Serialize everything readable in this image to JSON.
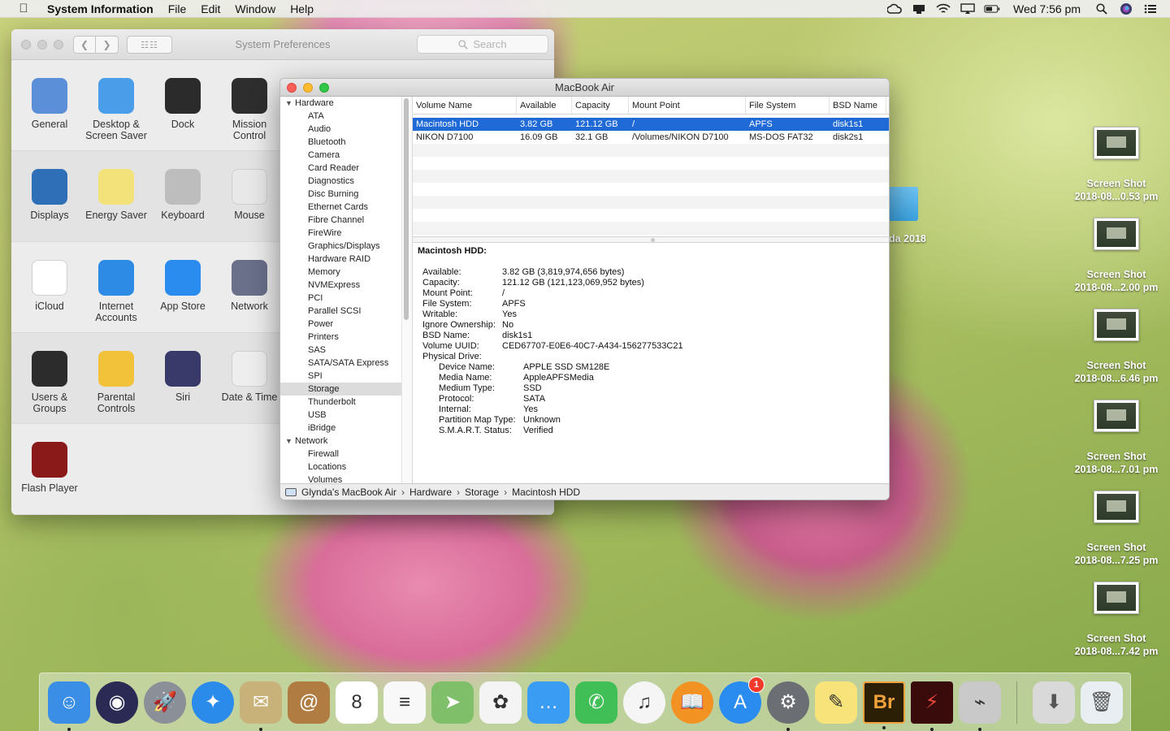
{
  "menubar": {
    "app_name": "System Information",
    "menus": [
      "File",
      "Edit",
      "Window",
      "Help"
    ],
    "clock": "Wed 7:56 pm",
    "status_icons": [
      "creative-cloud-icon",
      "notification-icon",
      "wifi-icon",
      "airplay-icon",
      "battery-icon",
      "search-icon",
      "siri-icon",
      "list-icon"
    ]
  },
  "sysprefs": {
    "title": "System Preferences",
    "search_placeholder": "Search",
    "rows": [
      [
        {
          "label": "General",
          "icon": "general-icon",
          "color": "#5b8fd8"
        },
        {
          "label": "Desktop & Screen Saver",
          "icon": "desktop-icon",
          "color": "#4a9de8"
        },
        {
          "label": "Dock",
          "icon": "dock-icon",
          "color": "#2b2b2b"
        },
        {
          "label": "Mission Control",
          "icon": "mission-control-icon",
          "color": "#2e2e2e"
        }
      ],
      [
        {
          "label": "Displays",
          "icon": "display-icon",
          "color": "#2f6fb7"
        },
        {
          "label": "Energy Saver",
          "icon": "lightbulb-icon",
          "color": "#f3e27a"
        },
        {
          "label": "Keyboard",
          "icon": "keyboard-icon",
          "color": "#bdbdbd"
        },
        {
          "label": "Mouse",
          "icon": "mouse-icon",
          "color": "#e8e8e8"
        }
      ],
      [
        {
          "label": "iCloud",
          "icon": "icloud-icon",
          "color": "#ffffff"
        },
        {
          "label": "Internet Accounts",
          "icon": "at-icon",
          "color": "#2d8be6"
        },
        {
          "label": "App Store",
          "icon": "app-store-icon",
          "color": "#2b8cf0"
        },
        {
          "label": "Network",
          "icon": "globe-icon",
          "color": "#6a6f8a"
        }
      ],
      [
        {
          "label": "Users & Groups",
          "icon": "users-icon",
          "color": "#2c2c2c"
        },
        {
          "label": "Parental Controls",
          "icon": "parental-icon",
          "color": "#f2c23a"
        },
        {
          "label": "Siri",
          "icon": "siri-icon",
          "color": "#3a3a6a"
        },
        {
          "label": "Date & Time",
          "icon": "clock-icon",
          "color": "#eeeeee"
        }
      ],
      [
        {
          "label": "Flash Player",
          "icon": "flash-icon",
          "color": "#8a1a1a"
        }
      ]
    ]
  },
  "sysinfo": {
    "title": "MacBook Air",
    "sidebar": {
      "hardware_label": "Hardware",
      "hardware_items": [
        "ATA",
        "Audio",
        "Bluetooth",
        "Camera",
        "Card Reader",
        "Diagnostics",
        "Disc Burning",
        "Ethernet Cards",
        "Fibre Channel",
        "FireWire",
        "Graphics/Displays",
        "Hardware RAID",
        "Memory",
        "NVMExpress",
        "PCI",
        "Parallel SCSI",
        "Power",
        "Printers",
        "SAS",
        "SATA/SATA Express",
        "SPI",
        "Storage",
        "Thunderbolt",
        "USB",
        "iBridge"
      ],
      "selected": "Storage",
      "network_label": "Network",
      "network_items": [
        "Firewall",
        "Locations",
        "Volumes"
      ]
    },
    "table": {
      "columns": [
        "Volume Name",
        "Available",
        "Capacity",
        "Mount Point",
        "File System",
        "BSD Name"
      ],
      "rows": [
        [
          "Macintosh HDD",
          "3.82 GB",
          "121.12 GB",
          "/",
          "APFS",
          "disk1s1"
        ],
        [
          "NIKON D7100",
          "16.09 GB",
          "32.1 GB",
          "/Volumes/NIKON D7100",
          "MS-DOS FAT32",
          "disk2s1"
        ]
      ]
    },
    "detail": {
      "title": "Macintosh HDD:",
      "fields": [
        {
          "k": "Available:",
          "v": "3.82 GB (3,819,974,656 bytes)"
        },
        {
          "k": "Capacity:",
          "v": "121.12 GB (121,123,069,952 bytes)"
        },
        {
          "k": "Mount Point:",
          "v": "/"
        },
        {
          "k": "File System:",
          "v": "APFS"
        },
        {
          "k": "Writable:",
          "v": "Yes"
        },
        {
          "k": "Ignore Ownership:",
          "v": "No"
        },
        {
          "k": "BSD Name:",
          "v": "disk1s1"
        },
        {
          "k": "Volume UUID:",
          "v": "CED67707-E0E6-40C7-A434-156277533C21"
        },
        {
          "k": "Physical Drive:",
          "v": ""
        }
      ],
      "drive_fields": [
        {
          "k": "Device Name:",
          "v": "APPLE SSD SM128E"
        },
        {
          "k": "Media Name:",
          "v": "AppleAPFSMedia"
        },
        {
          "k": "Medium Type:",
          "v": "SSD"
        },
        {
          "k": "Protocol:",
          "v": "SATA"
        },
        {
          "k": "Internal:",
          "v": "Yes"
        },
        {
          "k": "Partition Map Type:",
          "v": "Unknown"
        },
        {
          "k": "S.M.A.R.T. Status:",
          "v": "Verified"
        }
      ]
    },
    "path": [
      "Glynda's MacBook Air",
      "Hardware",
      "Storage",
      "Macintosh HDD"
    ]
  },
  "desktop": {
    "folder_label": "da 2018",
    "screenshots": [
      {
        "line1": "Screen Shot",
        "line2": "2018-08...0.53 pm"
      },
      {
        "line1": "Screen Shot",
        "line2": "2018-08...2.00 pm"
      },
      {
        "line1": "Screen Shot",
        "line2": "2018-08...6.46 pm"
      },
      {
        "line1": "Screen Shot",
        "line2": "2018-08...7.01 pm"
      },
      {
        "line1": "Screen Shot",
        "line2": "2018-08...7.25 pm"
      },
      {
        "line1": "Screen Shot",
        "line2": "2018-08...7.42 pm"
      }
    ]
  },
  "dock": {
    "apps": [
      {
        "name": "finder-icon",
        "glyph": "☺",
        "color": "#3a8ee6",
        "running": true
      },
      {
        "name": "siri-icon",
        "glyph": "◉",
        "color": "#2a2a55",
        "running": false
      },
      {
        "name": "launchpad-icon",
        "glyph": "🚀",
        "color": "#8a8f98",
        "running": false
      },
      {
        "name": "safari-icon",
        "glyph": "✦",
        "color": "#2b8bea",
        "running": false
      },
      {
        "name": "preview-icon",
        "glyph": "✉",
        "color": "#c9b27a",
        "running": true
      },
      {
        "name": "contacts-icon",
        "glyph": "@",
        "color": "#b07c42",
        "running": false
      },
      {
        "name": "calendar-icon",
        "glyph": "8",
        "color": "#ffffff",
        "running": false
      },
      {
        "name": "reminders-icon",
        "glyph": "≡",
        "color": "#f8f8f8",
        "running": false
      },
      {
        "name": "maps-icon",
        "glyph": "➤",
        "color": "#7fbf6a",
        "running": false
      },
      {
        "name": "photos-icon",
        "glyph": "✿",
        "color": "#f4f4f4",
        "running": false
      },
      {
        "name": "messages-icon",
        "glyph": "…",
        "color": "#3a9cf2",
        "running": false
      },
      {
        "name": "facetime-icon",
        "glyph": "✆",
        "color": "#3fbf55",
        "running": false
      },
      {
        "name": "itunes-icon",
        "glyph": "♫",
        "color": "#f5f5f5",
        "running": false
      },
      {
        "name": "ibooks-icon",
        "glyph": "📖",
        "color": "#f29223",
        "running": false
      },
      {
        "name": "app-store-icon",
        "glyph": "A",
        "color": "#2b8cf0",
        "running": false,
        "badge": "1"
      },
      {
        "name": "system-preferences-icon",
        "glyph": "⚙",
        "color": "#6b6f74",
        "running": true
      },
      {
        "name": "notes-icon",
        "glyph": "✎",
        "color": "#f7e37a",
        "running": false
      },
      {
        "name": "bridge-icon",
        "glyph": "Br",
        "color": "#2b1f05",
        "running": true
      },
      {
        "name": "acrobat-icon",
        "glyph": "⚡",
        "color": "#3a0b0b",
        "running": true
      },
      {
        "name": "system-information-icon",
        "glyph": "⌁",
        "color": "#c9c9c9",
        "running": true
      }
    ],
    "trailing": [
      {
        "name": "downloads-icon",
        "glyph": "⬇",
        "color": "#d9d9d9"
      },
      {
        "name": "trash-icon",
        "glyph": "🗑",
        "color": "#e9eef2"
      }
    ]
  }
}
